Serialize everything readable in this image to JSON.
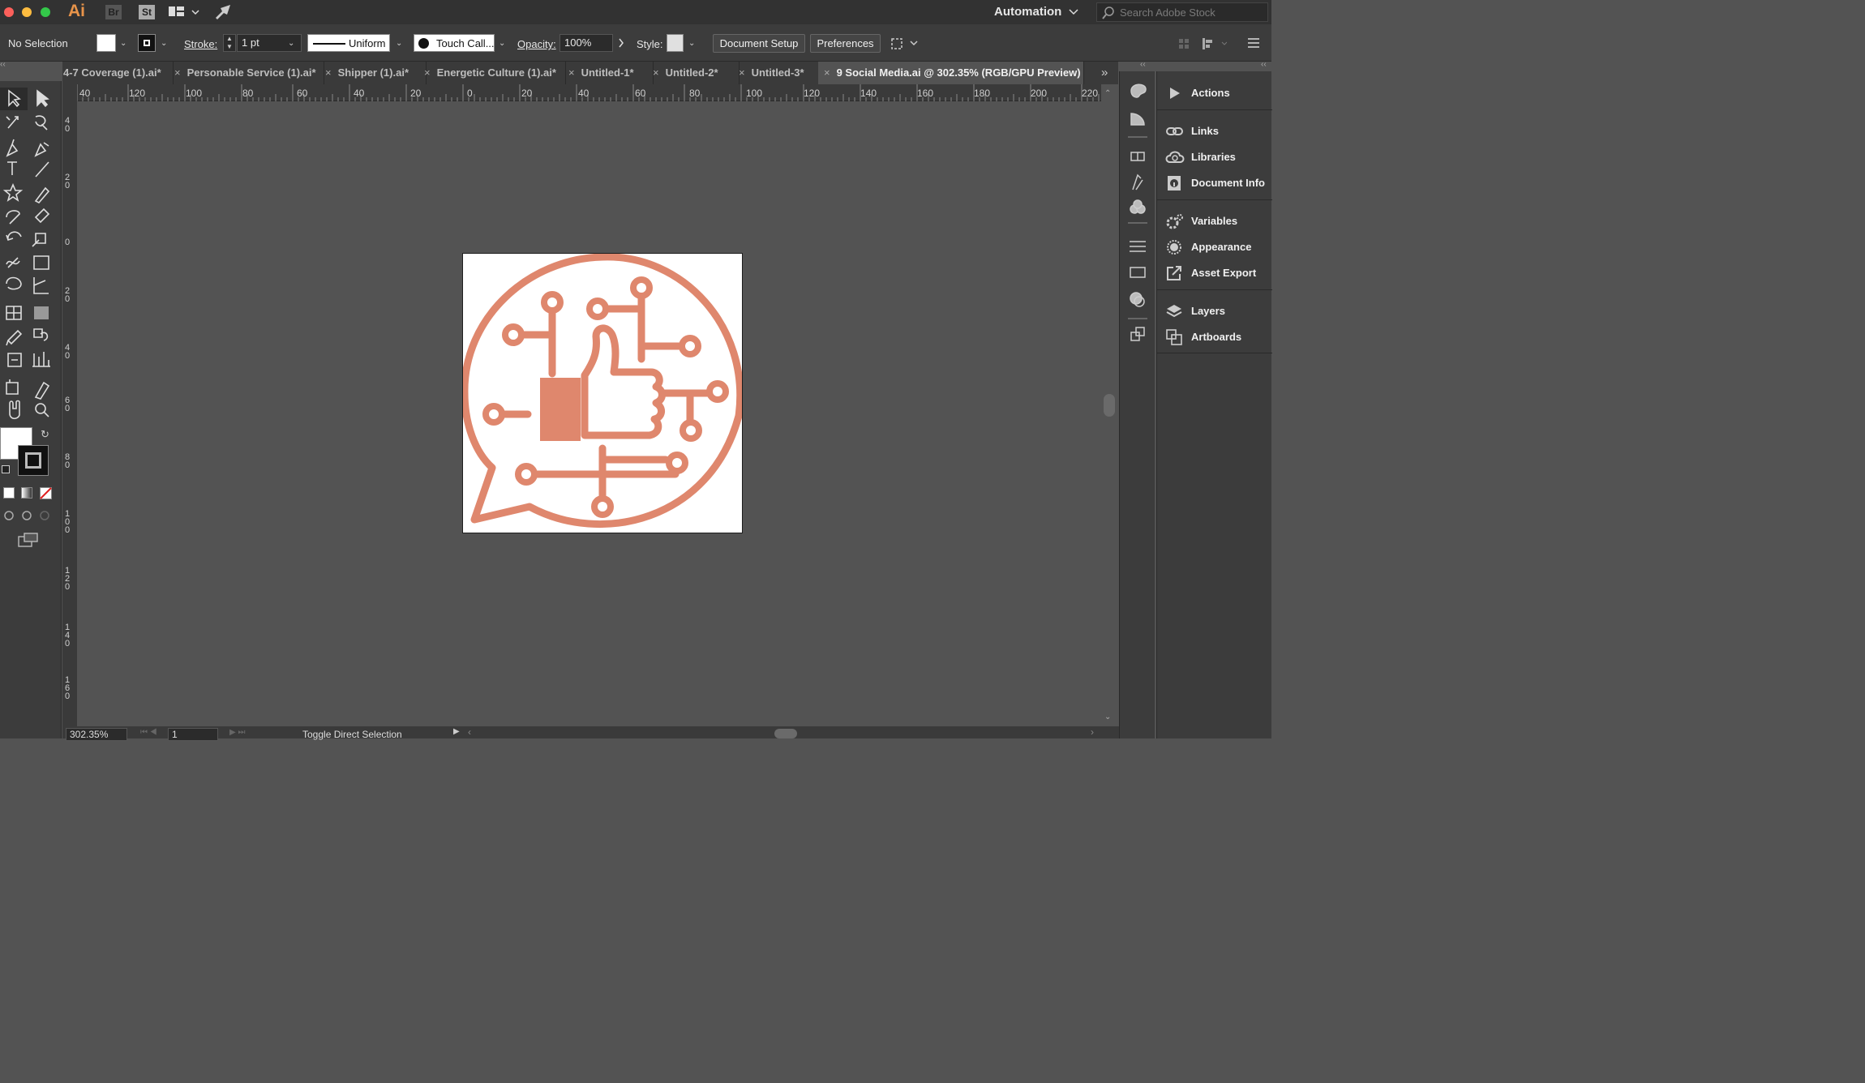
{
  "app": {
    "logo": "Ai",
    "bridge_label": "Br",
    "stock_label": "St",
    "workspace": "Automation",
    "search_placeholder": "Search Adobe Stock"
  },
  "control_bar": {
    "selection": "No Selection",
    "stroke_label": "Stroke:",
    "stroke_value": "1 pt",
    "profile": "Uniform",
    "brush": "Touch Call...",
    "opacity_label": "Opacity:",
    "opacity_value": "100%",
    "style_label": "Style:",
    "document_setup": "Document Setup",
    "preferences": "Preferences"
  },
  "tabs": [
    {
      "label": "4-7 Coverage (1).ai*",
      "active": false
    },
    {
      "label": "Personable Service (1).ai*",
      "active": false
    },
    {
      "label": "Shipper (1).ai*",
      "active": false
    },
    {
      "label": "Energetic Culture (1).ai*",
      "active": false
    },
    {
      "label": "Untitled-1*",
      "active": false
    },
    {
      "label": "Untitled-2*",
      "active": false
    },
    {
      "label": "Untitled-3*",
      "active": false
    },
    {
      "label": "9 Social Media.ai @ 302.35% (RGB/GPU Preview)",
      "active": true
    }
  ],
  "ruler": {
    "horizontal": [
      "40",
      "120",
      "100",
      "80",
      "60",
      "40",
      "20",
      "0",
      "20",
      "40",
      "60",
      "80",
      "100",
      "120",
      "140",
      "160",
      "180",
      "200",
      "220"
    ],
    "vertical": [
      "40",
      "20",
      "0",
      "20",
      "40",
      "60",
      "80",
      "100",
      "120",
      "140",
      "160"
    ]
  },
  "panels": {
    "items": [
      "Actions",
      "Links",
      "Libraries",
      "Document Info",
      "Variables",
      "Appearance",
      "Asset Export",
      "Layers",
      "Artboards"
    ]
  },
  "status": {
    "zoom": "302.35%",
    "artboard_number": "1",
    "status_text": "Toggle Direct Selection"
  },
  "colors": {
    "artwork": "#df876d",
    "canvas_bg": "#535353",
    "artboard": "#ffffff"
  }
}
